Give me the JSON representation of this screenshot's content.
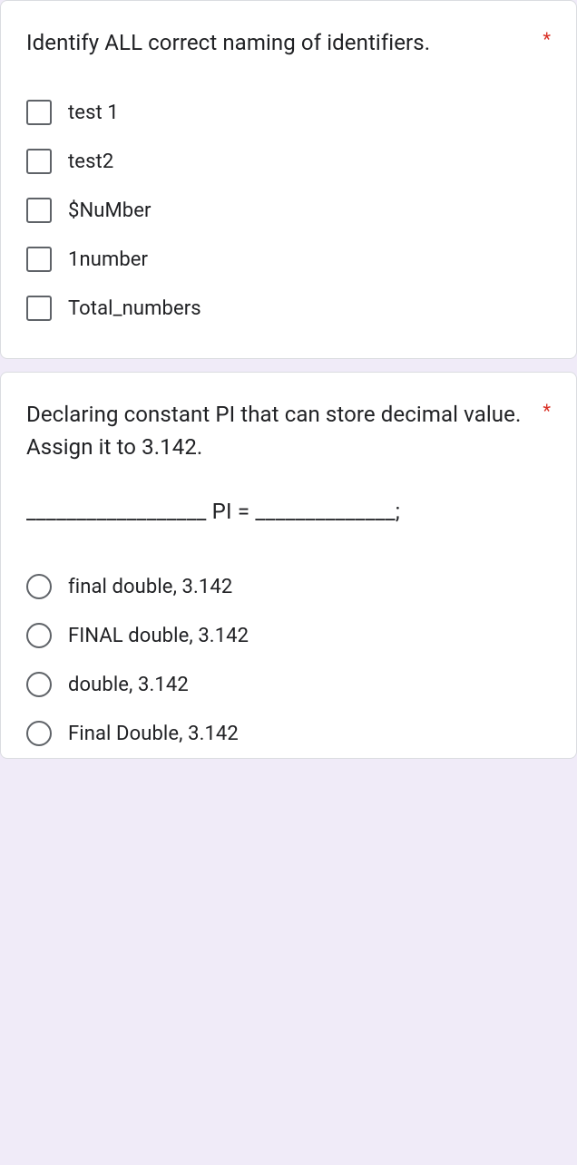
{
  "question1": {
    "text": "Identify ALL correct naming of identifiers.",
    "required": "*",
    "options": [
      "test 1",
      "test2",
      "$NuMber",
      "1number",
      "Total_numbers"
    ]
  },
  "question2": {
    "text": "Declaring constant PI that can store decimal value. Assign it to 3.142.",
    "required": "*",
    "fill_prompt": "__________________ PI = ______________;",
    "options": [
      "final double, 3.142",
      "FINAL double, 3.142",
      "double, 3.142",
      "Final Double, 3.142"
    ]
  }
}
